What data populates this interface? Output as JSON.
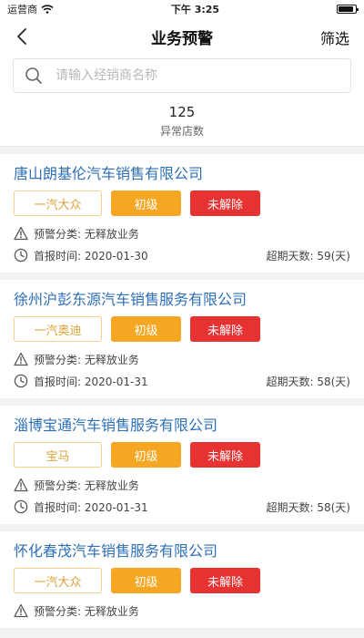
{
  "status_bar": {
    "carrier": "运营商",
    "time": "下午 3:25"
  },
  "nav": {
    "title": "业务预警",
    "filter": "筛选"
  },
  "search": {
    "placeholder": "请输入经销商名称"
  },
  "stats": {
    "count": "125",
    "label": "异常店数"
  },
  "cards": [
    {
      "name": "唐山朗基伦汽车销售有限公司",
      "brand": "一汽大众",
      "level": "初级",
      "status": "未解除",
      "category": "预警分类: 无释放业务",
      "report_date": "首报时间: 2020-01-30",
      "overdue": "超期天数: 59(天)"
    },
    {
      "name": "徐州沪彭东源汽车销售服务有限公司",
      "brand": "一汽奥迪",
      "level": "初级",
      "status": "未解除",
      "category": "预警分类: 无释放业务",
      "report_date": "首报时间: 2020-01-31",
      "overdue": "超期天数: 58(天)"
    },
    {
      "name": "淄博宝通汽车销售服务有限公司",
      "brand": "宝马",
      "level": "初级",
      "status": "未解除",
      "category": "预警分类: 无释放业务",
      "report_date": "首报时间: 2020-01-31",
      "overdue": "超期天数: 58(天)"
    },
    {
      "name": "怀化春茂汽车销售服务有限公司",
      "brand": "一汽大众",
      "level": "初级",
      "status": "未解除",
      "category": "预警分类: 无释放业务",
      "report_date": "",
      "overdue": ""
    }
  ],
  "icons": {
    "back": "chevron-left-icon",
    "search": "search-icon",
    "warning": "warning-triangle-icon",
    "clock": "clock-icon",
    "wifi": "wifi-icon",
    "battery": "battery-icon"
  },
  "battery": {
    "level": 0.9
  },
  "colors": {
    "link_blue": "#2e6fb8",
    "brand_border": "#f2cf8d",
    "brand_text": "#d9a23c",
    "level_orange": "#f5a623",
    "status_red": "#e73232"
  }
}
